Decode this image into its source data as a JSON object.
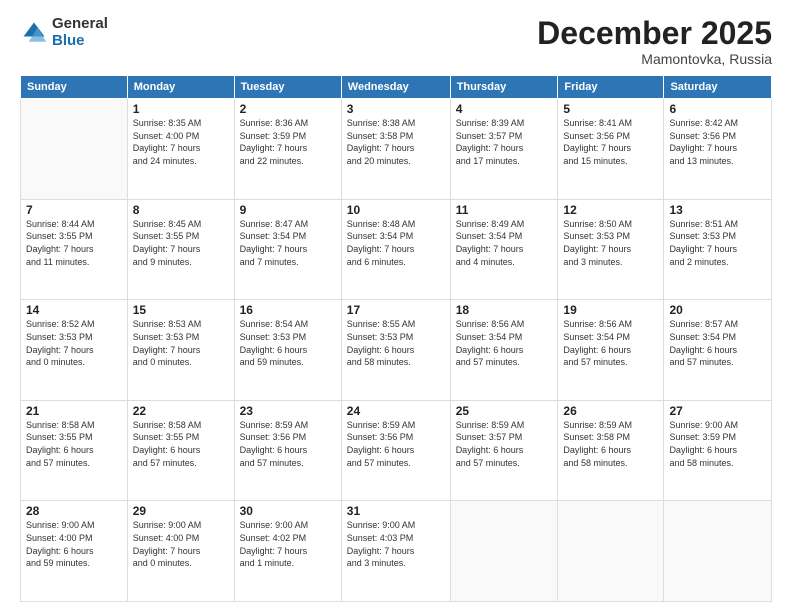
{
  "logo": {
    "general": "General",
    "blue": "Blue"
  },
  "title": "December 2025",
  "location": "Mamontovka, Russia",
  "days_header": [
    "Sunday",
    "Monday",
    "Tuesday",
    "Wednesday",
    "Thursday",
    "Friday",
    "Saturday"
  ],
  "weeks": [
    [
      {
        "day": "",
        "info": ""
      },
      {
        "day": "1",
        "info": "Sunrise: 8:35 AM\nSunset: 4:00 PM\nDaylight: 7 hours\nand 24 minutes."
      },
      {
        "day": "2",
        "info": "Sunrise: 8:36 AM\nSunset: 3:59 PM\nDaylight: 7 hours\nand 22 minutes."
      },
      {
        "day": "3",
        "info": "Sunrise: 8:38 AM\nSunset: 3:58 PM\nDaylight: 7 hours\nand 20 minutes."
      },
      {
        "day": "4",
        "info": "Sunrise: 8:39 AM\nSunset: 3:57 PM\nDaylight: 7 hours\nand 17 minutes."
      },
      {
        "day": "5",
        "info": "Sunrise: 8:41 AM\nSunset: 3:56 PM\nDaylight: 7 hours\nand 15 minutes."
      },
      {
        "day": "6",
        "info": "Sunrise: 8:42 AM\nSunset: 3:56 PM\nDaylight: 7 hours\nand 13 minutes."
      }
    ],
    [
      {
        "day": "7",
        "info": "Sunrise: 8:44 AM\nSunset: 3:55 PM\nDaylight: 7 hours\nand 11 minutes."
      },
      {
        "day": "8",
        "info": "Sunrise: 8:45 AM\nSunset: 3:55 PM\nDaylight: 7 hours\nand 9 minutes."
      },
      {
        "day": "9",
        "info": "Sunrise: 8:47 AM\nSunset: 3:54 PM\nDaylight: 7 hours\nand 7 minutes."
      },
      {
        "day": "10",
        "info": "Sunrise: 8:48 AM\nSunset: 3:54 PM\nDaylight: 7 hours\nand 6 minutes."
      },
      {
        "day": "11",
        "info": "Sunrise: 8:49 AM\nSunset: 3:54 PM\nDaylight: 7 hours\nand 4 minutes."
      },
      {
        "day": "12",
        "info": "Sunrise: 8:50 AM\nSunset: 3:53 PM\nDaylight: 7 hours\nand 3 minutes."
      },
      {
        "day": "13",
        "info": "Sunrise: 8:51 AM\nSunset: 3:53 PM\nDaylight: 7 hours\nand 2 minutes."
      }
    ],
    [
      {
        "day": "14",
        "info": "Sunrise: 8:52 AM\nSunset: 3:53 PM\nDaylight: 7 hours\nand 0 minutes."
      },
      {
        "day": "15",
        "info": "Sunrise: 8:53 AM\nSunset: 3:53 PM\nDaylight: 7 hours\nand 0 minutes."
      },
      {
        "day": "16",
        "info": "Sunrise: 8:54 AM\nSunset: 3:53 PM\nDaylight: 6 hours\nand 59 minutes."
      },
      {
        "day": "17",
        "info": "Sunrise: 8:55 AM\nSunset: 3:53 PM\nDaylight: 6 hours\nand 58 minutes."
      },
      {
        "day": "18",
        "info": "Sunrise: 8:56 AM\nSunset: 3:54 PM\nDaylight: 6 hours\nand 57 minutes."
      },
      {
        "day": "19",
        "info": "Sunrise: 8:56 AM\nSunset: 3:54 PM\nDaylight: 6 hours\nand 57 minutes."
      },
      {
        "day": "20",
        "info": "Sunrise: 8:57 AM\nSunset: 3:54 PM\nDaylight: 6 hours\nand 57 minutes."
      }
    ],
    [
      {
        "day": "21",
        "info": "Sunrise: 8:58 AM\nSunset: 3:55 PM\nDaylight: 6 hours\nand 57 minutes."
      },
      {
        "day": "22",
        "info": "Sunrise: 8:58 AM\nSunset: 3:55 PM\nDaylight: 6 hours\nand 57 minutes."
      },
      {
        "day": "23",
        "info": "Sunrise: 8:59 AM\nSunset: 3:56 PM\nDaylight: 6 hours\nand 57 minutes."
      },
      {
        "day": "24",
        "info": "Sunrise: 8:59 AM\nSunset: 3:56 PM\nDaylight: 6 hours\nand 57 minutes."
      },
      {
        "day": "25",
        "info": "Sunrise: 8:59 AM\nSunset: 3:57 PM\nDaylight: 6 hours\nand 57 minutes."
      },
      {
        "day": "26",
        "info": "Sunrise: 8:59 AM\nSunset: 3:58 PM\nDaylight: 6 hours\nand 58 minutes."
      },
      {
        "day": "27",
        "info": "Sunrise: 9:00 AM\nSunset: 3:59 PM\nDaylight: 6 hours\nand 58 minutes."
      }
    ],
    [
      {
        "day": "28",
        "info": "Sunrise: 9:00 AM\nSunset: 4:00 PM\nDaylight: 6 hours\nand 59 minutes."
      },
      {
        "day": "29",
        "info": "Sunrise: 9:00 AM\nSunset: 4:00 PM\nDaylight: 7 hours\nand 0 minutes."
      },
      {
        "day": "30",
        "info": "Sunrise: 9:00 AM\nSunset: 4:02 PM\nDaylight: 7 hours\nand 1 minute."
      },
      {
        "day": "31",
        "info": "Sunrise: 9:00 AM\nSunset: 4:03 PM\nDaylight: 7 hours\nand 3 minutes."
      },
      {
        "day": "",
        "info": ""
      },
      {
        "day": "",
        "info": ""
      },
      {
        "day": "",
        "info": ""
      }
    ]
  ]
}
